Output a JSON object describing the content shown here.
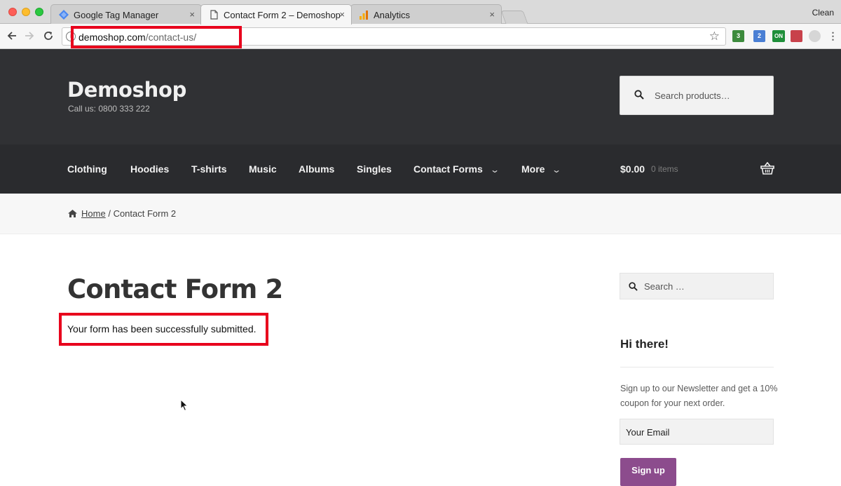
{
  "browser": {
    "tabs": [
      {
        "label": "Google Tag Manager",
        "icon": "gtm-icon",
        "active": false
      },
      {
        "label": "Contact Form 2 – Demoshop",
        "icon": "page-icon",
        "active": true
      },
      {
        "label": "Analytics",
        "icon": "analytics-icon",
        "active": false
      }
    ],
    "tab_close_glyph": "×",
    "profile_label": "Clean",
    "url": {
      "host": "demoshop.com",
      "path": "/contact-us/"
    },
    "extensions": [
      {
        "name": "tag-assistant-icon",
        "badge": "3",
        "color": "#3d8b3d"
      },
      {
        "name": "devtools-extension-icon",
        "badge": "2",
        "color": "#4a7fd4"
      },
      {
        "name": "on-toggle-icon",
        "badge": "ON",
        "color": "#1f8f3a"
      },
      {
        "name": "flag-extension-icon",
        "badge": "",
        "color": "#c8414b"
      },
      {
        "name": "ghost-extension-icon",
        "badge": "",
        "color": "#c9c9c9"
      },
      {
        "name": "menu-icon",
        "badge": "",
        "color": "#666666"
      }
    ]
  },
  "site": {
    "title": "Demoshop",
    "phone": "Call us: 0800 333 222",
    "search_placeholder": "Search products…",
    "nav": [
      {
        "label": "Clothing",
        "dropdown": false
      },
      {
        "label": "Hoodies",
        "dropdown": false
      },
      {
        "label": "T-shirts",
        "dropdown": false
      },
      {
        "label": "Music",
        "dropdown": false
      },
      {
        "label": "Albums",
        "dropdown": false
      },
      {
        "label": "Singles",
        "dropdown": false
      },
      {
        "label": "Contact Forms",
        "dropdown": true
      },
      {
        "label": "More",
        "dropdown": true
      }
    ],
    "cart": {
      "total": "$0.00",
      "count": "0 items"
    }
  },
  "breadcrumb": {
    "home": "Home",
    "separator": "/",
    "current": "Contact Form 2"
  },
  "main": {
    "title": "Contact Form 2",
    "message": "Your form has been successfully submitted."
  },
  "sidebar": {
    "search_placeholder": "Search …",
    "widget_title": "Hi there!",
    "widget_text": "Sign up to our Newsletter and get a 10% coupon for your next order.",
    "email_value": "Your Email",
    "signup_label": "Sign up"
  },
  "colors": {
    "header_bg": "#303134",
    "nav_bg": "#2a2b2e",
    "highlight": "#e8001c",
    "button": "#8c4c8d"
  }
}
